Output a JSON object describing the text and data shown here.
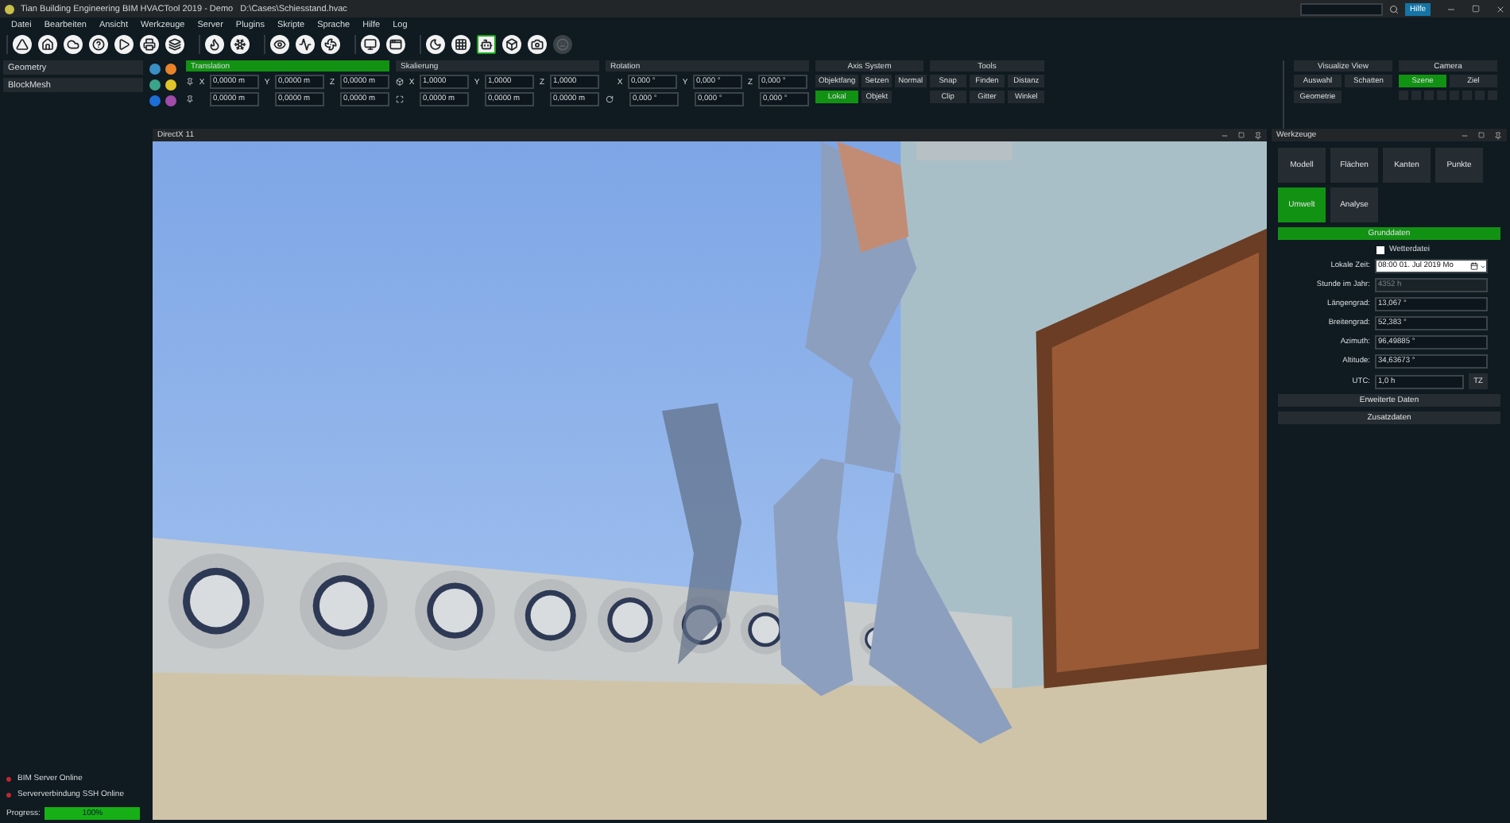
{
  "window": {
    "title": "Tian Building Engineering BIM HVACTool 2019 - Demo   D:\\Cases\\Schiesstand.hvac",
    "help_button": "Hilfe"
  },
  "menu": [
    "Datei",
    "Bearbeiten",
    "Ansicht",
    "Werkzeuge",
    "Server",
    "Plugins",
    "Skripte",
    "Sprache",
    "Hilfe",
    "Log"
  ],
  "toolbar": [
    [
      {
        "selected": false,
        "disabled": false
      },
      {
        "selected": false,
        "disabled": false
      },
      {
        "selected": false,
        "disabled": false
      },
      {
        "selected": false,
        "disabled": false
      },
      {
        "selected": false,
        "disabled": false
      },
      {
        "selected": false,
        "disabled": false
      },
      {
        "selected": false,
        "disabled": false
      }
    ],
    [
      {
        "selected": false,
        "disabled": false
      },
      {
        "selected": false,
        "disabled": false
      }
    ],
    [
      {
        "selected": false,
        "disabled": false
      },
      {
        "selected": false,
        "disabled": false
      },
      {
        "selected": false,
        "disabled": false
      }
    ],
    [
      {
        "selected": false,
        "disabled": false
      },
      {
        "selected": false,
        "disabled": false
      }
    ],
    [
      {
        "selected": false,
        "disabled": false
      },
      {
        "selected": false,
        "disabled": false
      },
      {
        "selected": true,
        "disabled": false
      },
      {
        "selected": false,
        "disabled": false
      },
      {
        "selected": false,
        "disabled": false
      },
      {
        "selected": false,
        "disabled": true
      }
    ]
  ],
  "sidebar": {
    "items": [
      "Geometry",
      "BlockMesh"
    ]
  },
  "tool_strip": [
    {
      "color": "#3a8fc4"
    },
    {
      "color": "#e8832a"
    },
    {
      "color": "#3aa58a"
    },
    {
      "color": "#e0c52a"
    },
    {
      "color": "#1c6fd6"
    },
    {
      "color": "#a04ca8"
    }
  ],
  "transform_groups": [
    {
      "title": "Translation",
      "active": true,
      "rows": [
        [
          {
            "axis": "X",
            "value": "0,0000 m"
          },
          {
            "axis": "Y",
            "value": "0,0000 m"
          },
          {
            "axis": "Z",
            "value": "0,0000 m"
          }
        ],
        [
          {
            "value": "0,0000 m"
          },
          {
            "value": "0,0000 m"
          },
          {
            "value": "0,0000 m"
          }
        ]
      ]
    },
    {
      "title": "Skalierung",
      "active": false,
      "rows": [
        [
          {
            "axis": "X",
            "value": "1,0000"
          },
          {
            "axis": "Y",
            "value": "1,0000"
          },
          {
            "axis": "Z",
            "value": "1,0000"
          }
        ],
        [
          {
            "value": "0,0000 m"
          },
          {
            "value": "0,0000 m"
          },
          {
            "value": "0,0000 m"
          }
        ]
      ]
    },
    {
      "title": "Rotation",
      "active": false,
      "rows": [
        [
          {
            "axis": "X",
            "value": "0,000 °"
          },
          {
            "axis": "Y",
            "value": "0,000 °"
          },
          {
            "axis": "Z",
            "value": "0,000 °"
          }
        ],
        [
          {
            "value": "0,000 °"
          },
          {
            "value": "0,000 °"
          },
          {
            "value": "0,000 °"
          }
        ]
      ]
    }
  ],
  "button_groups": [
    {
      "title": "Axis System",
      "buttons": [
        {
          "label": "Objektfang",
          "selected": false
        },
        {
          "label": "Setzen",
          "selected": false
        },
        {
          "label": "Normal",
          "selected": false
        },
        {
          "label": "Lokal",
          "selected": true
        },
        {
          "label": "Objekt",
          "selected": false
        }
      ]
    },
    {
      "title": "Tools",
      "buttons": [
        {
          "label": "Snap",
          "selected": false
        },
        {
          "label": "Finden",
          "selected": false
        },
        {
          "label": "Distanz",
          "selected": false
        },
        {
          "label": "Clip",
          "selected": false
        },
        {
          "label": "Gitter",
          "selected": false
        },
        {
          "label": "Winkel",
          "selected": false
        }
      ]
    }
  ],
  "view_groups": [
    {
      "title": "Visualize View",
      "buttons": [
        {
          "label": "Auswahl",
          "selected": false
        },
        {
          "label": "Schatten",
          "selected": false
        },
        {
          "label": "Geometrie",
          "selected": false
        }
      ]
    },
    {
      "title": "Camera",
      "buttons": [
        {
          "label": "Szene",
          "selected": true
        },
        {
          "label": "Ziel",
          "selected": false
        }
      ]
    }
  ],
  "status": [
    {
      "label": "BIM Server Online",
      "color": "#c0282d"
    },
    {
      "label": "Serververbindung SSH Online",
      "color": "#c0282d"
    }
  ],
  "progress": {
    "label": "Progress:",
    "level": 1,
    "text": "100%"
  },
  "viewport": {
    "title": "DirectX 11"
  },
  "tools_panel": {
    "title": "Werkzeuge",
    "tabs": [
      {
        "label": "Modell",
        "selected": false
      },
      {
        "label": "Flächen",
        "selected": false
      },
      {
        "label": "Kanten",
        "selected": false
      },
      {
        "label": "Punkte",
        "selected": false
      },
      {
        "label": "Umwelt",
        "selected": true
      },
      {
        "label": "Analyse",
        "selected": false
      }
    ],
    "sections": [
      {
        "label": "Grunddaten",
        "expanded": true
      },
      {
        "label": "Erweiterte Daten",
        "expanded": false
      },
      {
        "label": "Zusatzdaten",
        "expanded": false
      }
    ],
    "checkbox": {
      "label": "Wetterdatei",
      "checked": false
    },
    "fields": [
      {
        "label": "Lokale Zeit:",
        "value": "08:00 01. Jul  2019 Mo",
        "kind": "date",
        "disabled": false
      },
      {
        "label": "Stunde im Jahr:",
        "value": "4352 h",
        "kind": "text",
        "disabled": true
      },
      {
        "label": "Längengrad:",
        "value": "13,067 °",
        "kind": "text",
        "disabled": false
      },
      {
        "label": "Breitengrad:",
        "value": "52,383 °",
        "kind": "text",
        "disabled": false
      },
      {
        "label": "Azimuth:",
        "value": "96,49885 °",
        "kind": "text",
        "disabled": false
      },
      {
        "label": "Altitude:",
        "value": "34,63673 °",
        "kind": "text",
        "disabled": false
      },
      {
        "label": "UTC:",
        "value": "1,0 h",
        "kind": "button",
        "button": "TZ",
        "disabled": false
      }
    ]
  }
}
